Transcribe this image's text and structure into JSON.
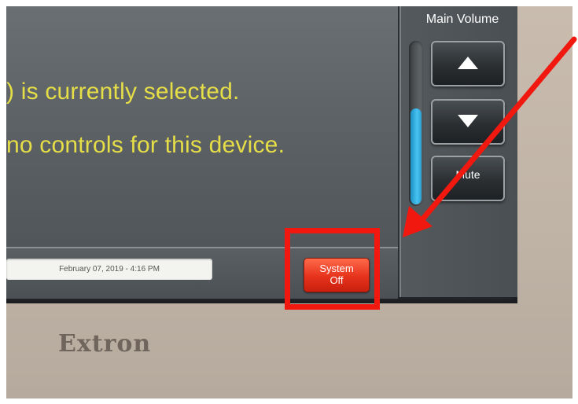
{
  "screen": {
    "message_line_1": ") is currently selected.",
    "message_line_2": "no controls for this device.",
    "date_time": "February 07, 2019  -  4:16 PM",
    "system_off_label_1": "System",
    "system_off_label_2": "Off"
  },
  "volume": {
    "title": "Main Volume",
    "level_fraction": 0.58,
    "up_icon": "triangle-up-icon",
    "down_icon": "triangle-down-icon",
    "mute_label": "Mute"
  },
  "bezel": {
    "brand": "Extron"
  },
  "colors": {
    "message_text": "#e6de47",
    "system_off_button": "#e6321c",
    "annotation_red": "#f0180f",
    "volume_meter": "#48c4f2"
  }
}
